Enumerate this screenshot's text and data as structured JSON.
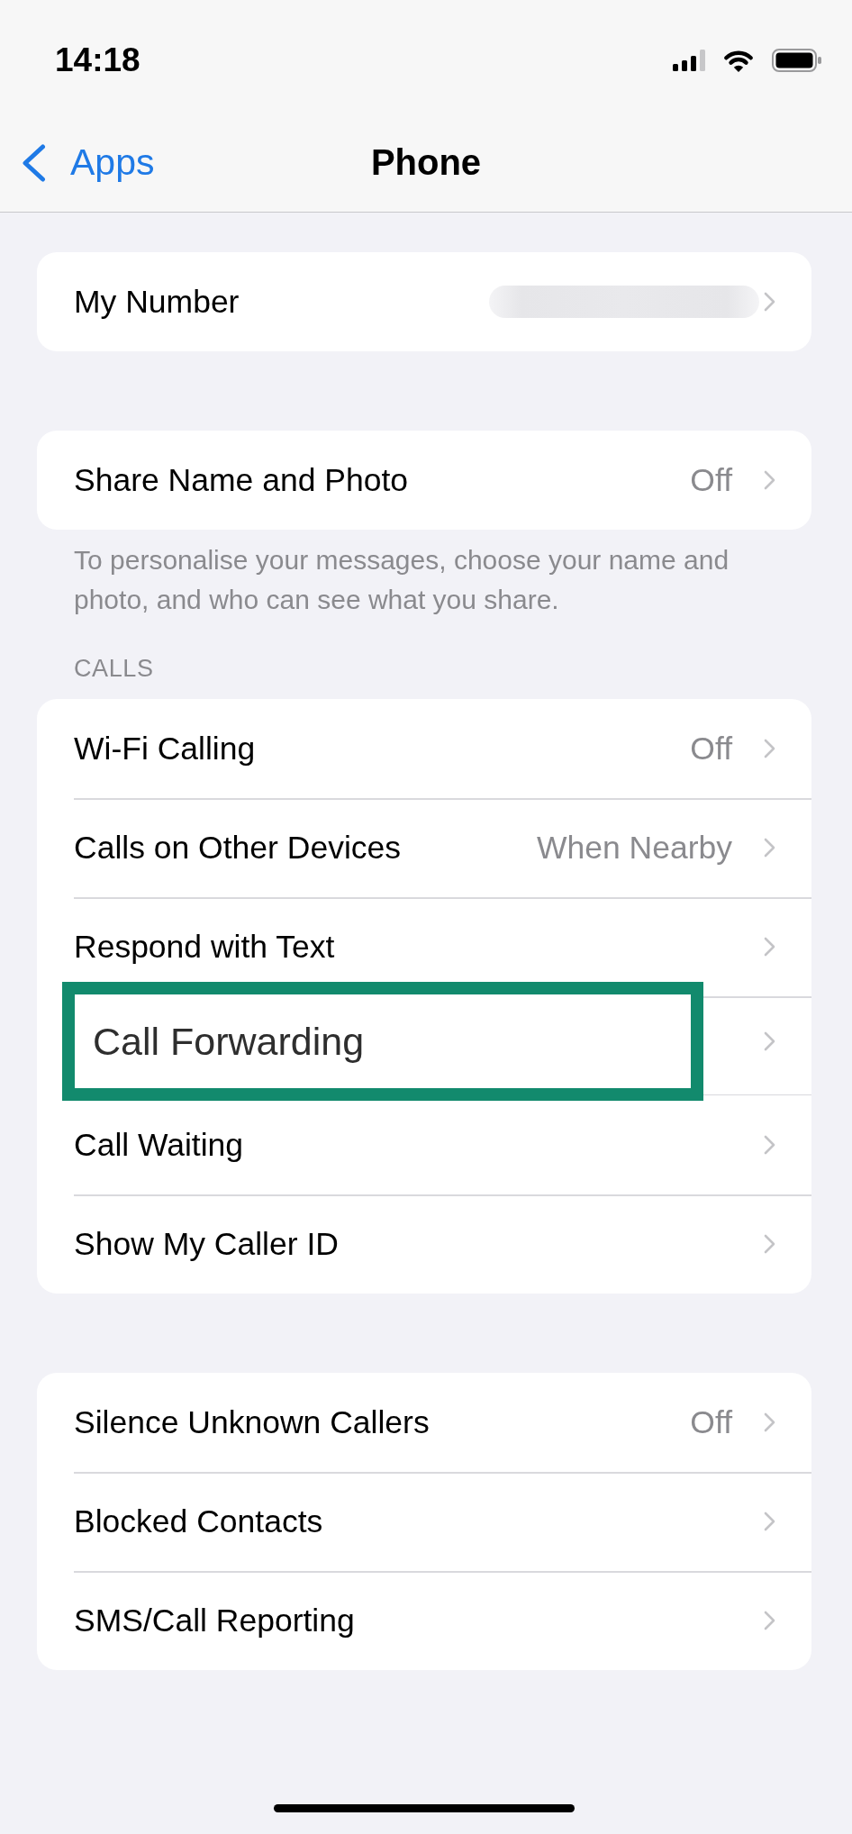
{
  "status_bar": {
    "time": "14:18"
  },
  "nav": {
    "back": "Apps",
    "title": "Phone"
  },
  "sections": [
    {
      "rows": [
        {
          "label": "My Number",
          "redacted": true,
          "highlighted": false
        }
      ]
    },
    {
      "rows": [
        {
          "label": "Share Name and Photo",
          "value": "Off",
          "redacted": false,
          "highlighted": false
        }
      ],
      "footer": "To personalise your messages, choose your name and photo, and who can see what you share."
    },
    {
      "header": "CALLS",
      "rows": [
        {
          "label": "Wi-Fi Calling",
          "value": "Off",
          "redacted": false,
          "highlighted": false
        },
        {
          "label": "Calls on Other Devices",
          "value": "When Nearby",
          "redacted": false,
          "highlighted": false
        },
        {
          "label": "Respond with Text",
          "redacted": false,
          "highlighted": false
        },
        {
          "label": "Call Forwarding",
          "redacted": false,
          "highlighted": true
        },
        {
          "label": "Call Waiting",
          "redacted": false,
          "highlighted": false
        },
        {
          "label": "Show My Caller ID",
          "redacted": false,
          "highlighted": false
        }
      ]
    },
    {
      "rows": [
        {
          "label": "Silence Unknown Callers",
          "value": "Off",
          "redacted": false,
          "highlighted": false
        },
        {
          "label": "Blocked Contacts",
          "redacted": false,
          "highlighted": false
        },
        {
          "label": "SMS/Call Reporting",
          "redacted": false,
          "highlighted": false
        }
      ]
    }
  ]
}
